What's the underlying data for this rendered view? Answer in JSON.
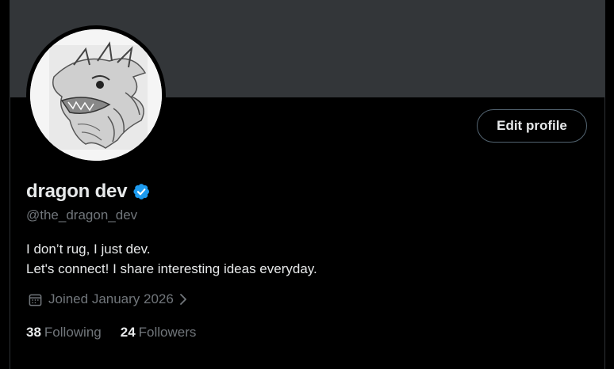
{
  "profile": {
    "display_name": "dragon dev",
    "handle": "@the_dragon_dev",
    "verified": true,
    "bio_lines": [
      "I don’t rug, I just dev.",
      "Let's connect! I share interesting ideas everyday."
    ],
    "joined": "Joined January 2026",
    "following_count": "38",
    "following_label": "Following",
    "followers_count": "24",
    "followers_label": "Followers"
  },
  "actions": {
    "edit_profile_label": "Edit profile"
  },
  "icons": {
    "verified": "verified-badge-icon",
    "joined": "calendar-icon",
    "joined_more": "chevron-right-icon"
  },
  "colors": {
    "background": "#000000",
    "banner": "#333639",
    "text_primary": "#e7e9ea",
    "text_secondary": "#71767b",
    "verified_blue": "#1d9bf0",
    "button_border": "#536471"
  }
}
